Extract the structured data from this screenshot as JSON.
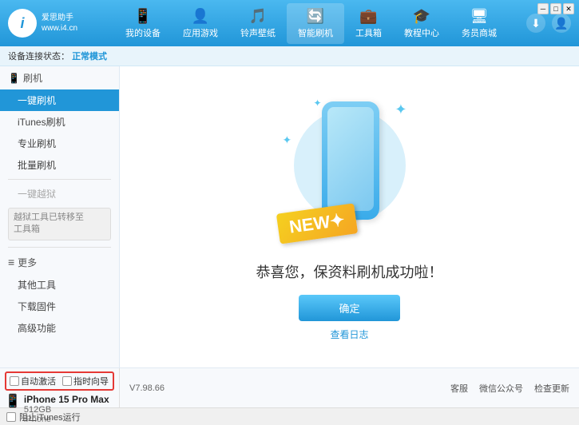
{
  "app": {
    "logo_text": "爱思助手\nwww.i4.cn",
    "logo_letter": "i",
    "window_title": "爱思助手"
  },
  "nav": {
    "items": [
      {
        "id": "my-device",
        "icon": "📱",
        "label": "我的设备"
      },
      {
        "id": "apps-games",
        "icon": "👤",
        "label": "应用游戏"
      },
      {
        "id": "ringtone",
        "icon": "🎵",
        "label": "铃声壁纸"
      },
      {
        "id": "smart-flash",
        "icon": "🔄",
        "label": "智能刷机",
        "active": true
      },
      {
        "id": "toolbox",
        "icon": "💼",
        "label": "工具箱"
      },
      {
        "id": "tutorial",
        "icon": "🎓",
        "label": "教程中心"
      },
      {
        "id": "service",
        "icon": "🖥",
        "label": "务员商城"
      }
    ],
    "download_icon": "⬇",
    "account_icon": "👤"
  },
  "status": {
    "prefix": "设备连接状态：",
    "mode_label": "正常模式"
  },
  "sidebar": {
    "flash_section": {
      "icon": "📱",
      "label": "刷机"
    },
    "items": [
      {
        "id": "one-key-flash",
        "label": "一键刷机",
        "active": true
      },
      {
        "id": "itunes-flash",
        "label": "iTunes刷机"
      },
      {
        "id": "pro-flash",
        "label": "专业刷机"
      },
      {
        "id": "batch-flash",
        "label": "批量刷机"
      }
    ],
    "disabled_item": "一键越狱",
    "note_text": "越狱工具已转移至\n工具箱",
    "more_section": "更多",
    "more_items": [
      {
        "id": "other-tools",
        "label": "其他工具"
      },
      {
        "id": "download-fw",
        "label": "下载固件"
      },
      {
        "id": "advanced",
        "label": "高级功能"
      }
    ]
  },
  "content": {
    "success_text": "恭喜您，保资料刷机成功啦！",
    "confirm_button": "确定",
    "log_link": "查看日志"
  },
  "bottom": {
    "checkboxes": [
      {
        "id": "auto-activate",
        "label": "自动激活"
      },
      {
        "id": "timed-guide",
        "label": "指时向导"
      }
    ],
    "device": {
      "name": "iPhone 15 Pro Max",
      "storage": "512GB",
      "type": "iPhone"
    },
    "version": "V7.98.66",
    "links": [
      {
        "id": "home",
        "label": "客服"
      },
      {
        "id": "wechat",
        "label": "微信公众号"
      },
      {
        "id": "check-update",
        "label": "检查更新"
      }
    ],
    "itunes_label": "阻止iTunes运行"
  }
}
